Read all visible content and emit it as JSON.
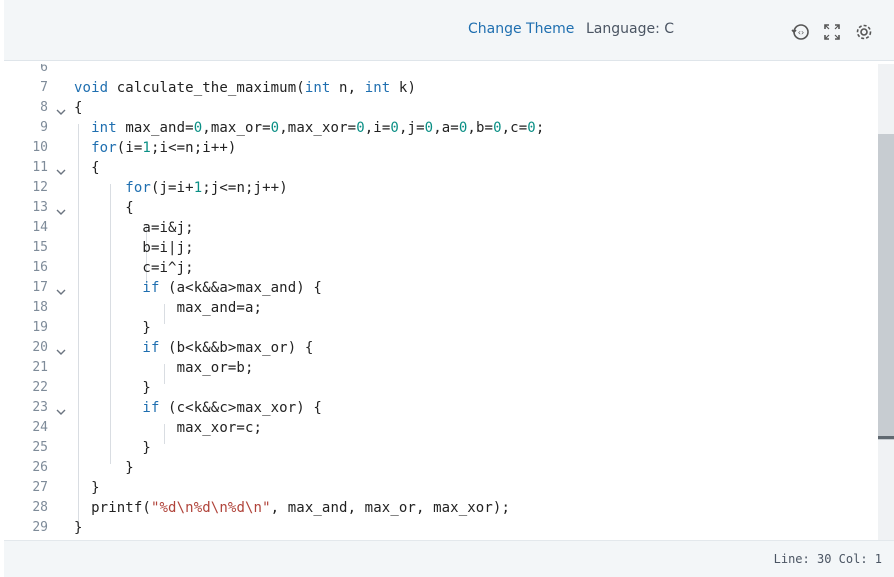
{
  "toolbar": {
    "change_theme": "Change Theme",
    "language_label": "Language: C",
    "icons": [
      "history-icon",
      "fullscreen-icon",
      "gear-icon"
    ]
  },
  "editor": {
    "lines": [
      {
        "no": "6",
        "text": ""
      },
      {
        "no": "7",
        "text": "void calculate_the_maximum(int n, int k)"
      },
      {
        "no": "8",
        "text": "{"
      },
      {
        "no": "9",
        "text": "  int max_and=0,max_or=0,max_xor=0,i=0,j=0,a=0,b=0,c=0;"
      },
      {
        "no": "10",
        "text": "  for(i=1;i<=n;i++)"
      },
      {
        "no": "11",
        "text": "  {"
      },
      {
        "no": "12",
        "text": "      for(j=i+1;j<=n;j++)"
      },
      {
        "no": "13",
        "text": "      {"
      },
      {
        "no": "14",
        "text": "        a=i&j;"
      },
      {
        "no": "15",
        "text": "        b=i|j;"
      },
      {
        "no": "16",
        "text": "        c=i^j;"
      },
      {
        "no": "17",
        "text": "        if (a<k&&a>max_and) {"
      },
      {
        "no": "18",
        "text": "            max_and=a;"
      },
      {
        "no": "19",
        "text": "        }"
      },
      {
        "no": "20",
        "text": "        if (b<k&&b>max_or) {"
      },
      {
        "no": "21",
        "text": "            max_or=b;"
      },
      {
        "no": "22",
        "text": "        }"
      },
      {
        "no": "23",
        "text": "        if (c<k&&c>max_xor) {"
      },
      {
        "no": "24",
        "text": "            max_xor=c;"
      },
      {
        "no": "25",
        "text": "        }"
      },
      {
        "no": "26",
        "text": "      }"
      },
      {
        "no": "27",
        "text": "  }"
      },
      {
        "no": "28",
        "text": "  printf(\"%d\\n%d\\n%d\\n\", max_and, max_or, max_xor);"
      },
      {
        "no": "29",
        "text": "}"
      }
    ],
    "folds": [
      "8",
      "11",
      "13",
      "17",
      "20",
      "23"
    ]
  },
  "status": {
    "position": "Line: 30 Col: 1"
  },
  "colors": {
    "keyword": "#1f6fb0",
    "number": "#0a8f85",
    "string": "#b0433a"
  }
}
